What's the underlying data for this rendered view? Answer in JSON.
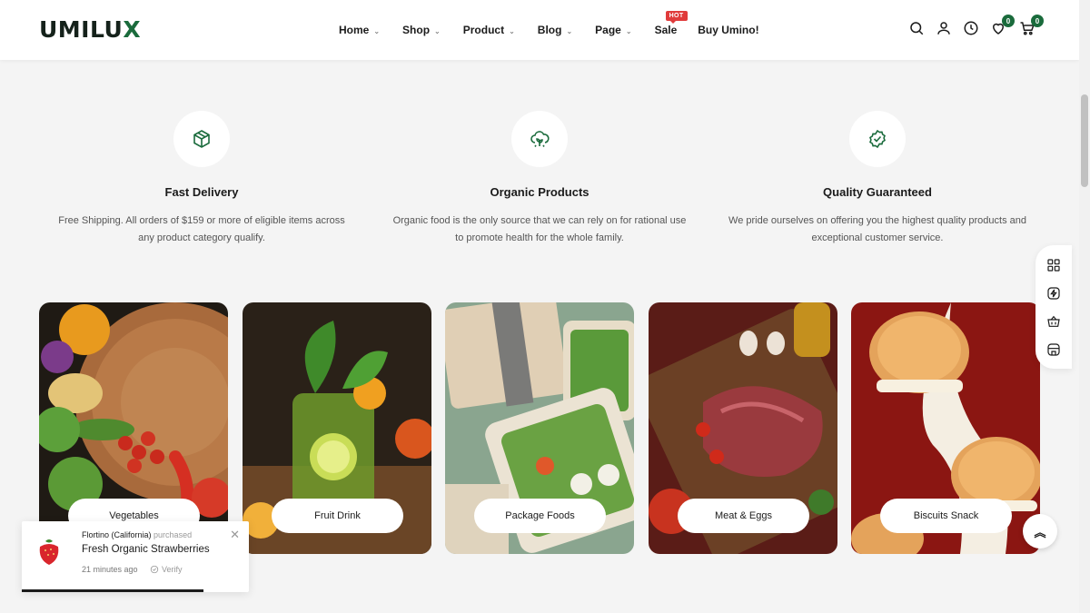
{
  "brand": {
    "logo_main": "UMILU",
    "logo_accent": "X",
    "accent_color": "#1a6b3c"
  },
  "nav": {
    "items": [
      {
        "label": "Home",
        "has_dropdown": true
      },
      {
        "label": "Shop",
        "has_dropdown": true
      },
      {
        "label": "Product",
        "has_dropdown": true
      },
      {
        "label": "Blog",
        "has_dropdown": true
      },
      {
        "label": "Page",
        "has_dropdown": true
      },
      {
        "label": "Sale",
        "has_dropdown": false
      },
      {
        "label": "Buy Umino!",
        "has_dropdown": false
      }
    ],
    "hot_badge": "HOT"
  },
  "header_icons": {
    "search": "search-icon",
    "account": "user-icon",
    "history": "clock-icon",
    "wishlist": "heart-icon",
    "wishlist_count": "0",
    "cart": "cart-icon",
    "cart_count": "0"
  },
  "features": [
    {
      "icon": "box-icon",
      "title": "Fast Delivery",
      "desc": "Free Shipping. All orders of $159 or more of eligible items across any product category qualify."
    },
    {
      "icon": "plant-cloud-icon",
      "title": "Organic Products",
      "desc": "Organic food is the only source that we can rely on for rational use to promote health for the whole family."
    },
    {
      "icon": "badge-check-icon",
      "title": "Quality Guaranteed",
      "desc": "We pride ourselves on offering you the highest quality products and exceptional customer service."
    }
  ],
  "categories": [
    {
      "label": "Vegetables"
    },
    {
      "label": "Fruit Drink"
    },
    {
      "label": "Package Foods"
    },
    {
      "label": "Meat & Eggs"
    },
    {
      "label": "Biscuits Snack"
    }
  ],
  "side_tools": [
    "grid-icon",
    "lightning-icon",
    "basket-icon",
    "store-icon"
  ],
  "toast": {
    "buyer": "Flortino (California)",
    "action": "purchased",
    "product": "Fresh Organic Strawberries",
    "time": "21 minutes ago",
    "verify": "Verify"
  }
}
